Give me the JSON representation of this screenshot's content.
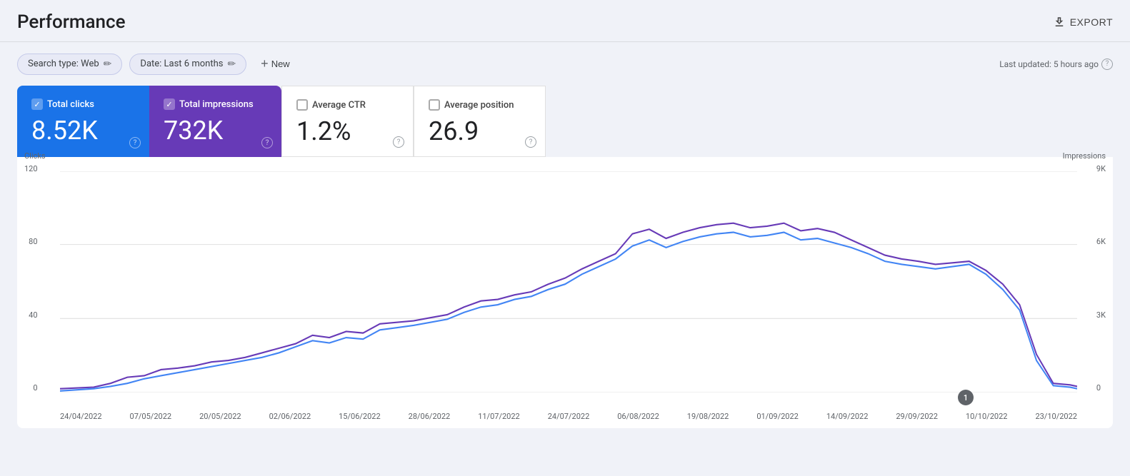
{
  "header": {
    "title": "Performance",
    "export_label": "EXPORT"
  },
  "toolbar": {
    "search_type_label": "Search type: Web",
    "date_label": "Date: Last 6 months",
    "new_label": "New",
    "last_updated": "Last updated: 5 hours ago"
  },
  "metrics": [
    {
      "id": "total-clicks",
      "label": "Total clicks",
      "value": "8.52K",
      "checked": true,
      "style": "active-blue"
    },
    {
      "id": "total-impressions",
      "label": "Total impressions",
      "value": "732K",
      "checked": true,
      "style": "active-purple"
    },
    {
      "id": "average-ctr",
      "label": "Average CTR",
      "value": "1.2%",
      "checked": false,
      "style": "inactive"
    },
    {
      "id": "average-position",
      "label": "Average position",
      "value": "26.9",
      "checked": false,
      "style": "inactive"
    }
  ],
  "chart": {
    "y_left_label": "Clicks",
    "y_right_label": "Impressions",
    "y_left_values": [
      "120",
      "80",
      "40",
      "0"
    ],
    "y_right_values": [
      "9K",
      "6K",
      "3K",
      "0"
    ],
    "x_labels": [
      "24/04/2022",
      "07/05/2022",
      "20/05/2022",
      "02/06/2022",
      "15/06/2022",
      "28/06/2022",
      "11/07/2022",
      "24/07/2022",
      "06/08/2022",
      "19/08/2022",
      "01/09/2022",
      "14/09/2022",
      "29/09/2022",
      "10/10/2022",
      "23/10/2022"
    ],
    "annotation": "1"
  },
  "colors": {
    "clicks_line": "#4285f4",
    "impressions_line": "#673ab7",
    "grid": "#e0e0e0",
    "active_blue": "#1a73e8",
    "active_purple": "#673ab7"
  }
}
